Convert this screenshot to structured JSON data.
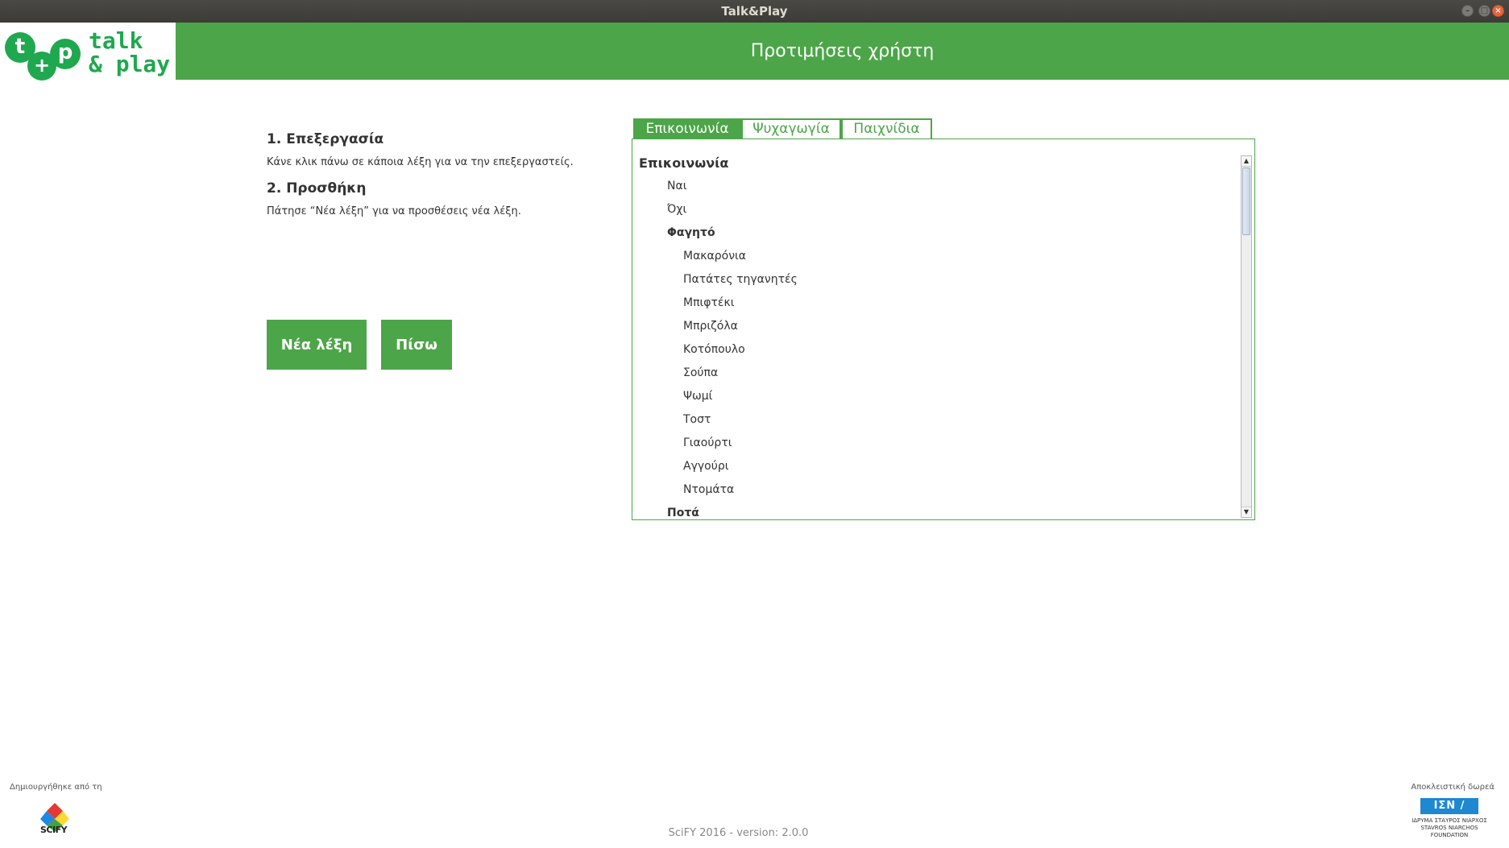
{
  "window": {
    "title": "Talk&Play"
  },
  "header": {
    "logo": {
      "t": "t",
      "p": "p",
      "plus": "+",
      "line1": "talk",
      "line2": "& play"
    },
    "title": "Προτιμήσεις χρήστη"
  },
  "instructions": {
    "step1_title": "1. Επεξεργασία",
    "step1_text": "Κάνε κλικ πάνω σε κάποια λέξη για να την επεξεργαστείς.",
    "step2_title": "2. Προσθήκη",
    "step2_text": "Πάτησε “Νέα λέξη” για να προσθέσεις νέα λέξη."
  },
  "buttons": {
    "new_word": "Νέα λέξη",
    "back": "Πίσω"
  },
  "tabs": [
    {
      "label": "Επικοινωνία",
      "active": true
    },
    {
      "label": "Ψυχαγωγία",
      "active": false
    },
    {
      "label": "Παιχνίδια",
      "active": false
    }
  ],
  "tree": {
    "root": "Επικοινωνία",
    "items": [
      {
        "label": "Ναι",
        "level": 1
      },
      {
        "label": "Όχι",
        "level": 1
      },
      {
        "label": "Φαγητό",
        "level": 1,
        "category": true
      },
      {
        "label": "Μακαρόνια",
        "level": 2
      },
      {
        "label": "Πατάτες τηγανητές",
        "level": 2
      },
      {
        "label": "Μπιφτέκι",
        "level": 2
      },
      {
        "label": "Μπριζόλα",
        "level": 2
      },
      {
        "label": "Κοτόπουλο",
        "level": 2
      },
      {
        "label": "Σούπα",
        "level": 2
      },
      {
        "label": "Ψωμί",
        "level": 2
      },
      {
        "label": "Τοστ",
        "level": 2
      },
      {
        "label": "Γιαούρτι",
        "level": 2
      },
      {
        "label": "Αγγούρι",
        "level": 2
      },
      {
        "label": "Ντομάτα",
        "level": 2
      },
      {
        "label": "Ποτά",
        "level": 1,
        "category": true
      }
    ]
  },
  "footer": {
    "created_by": "Δημιουργήθηκε από τη",
    "scify_label": "SCIFY",
    "version": "SciFY 2016 - version: 2.0.0",
    "donation": "Αποκλειστική δωρεά",
    "snf_mark": "ΙΣΝ / SNF",
    "snf_line1": "ΙΔΡΥΜΑ ΣΤΑΥΡΟΣ ΝΙΑΡΧΟΣ",
    "snf_line2": "STAVROS NIARCHOS",
    "snf_line3": "FOUNDATION"
  },
  "colors": {
    "brand_green": "#4ca548",
    "logo_green": "#1fa84f"
  }
}
